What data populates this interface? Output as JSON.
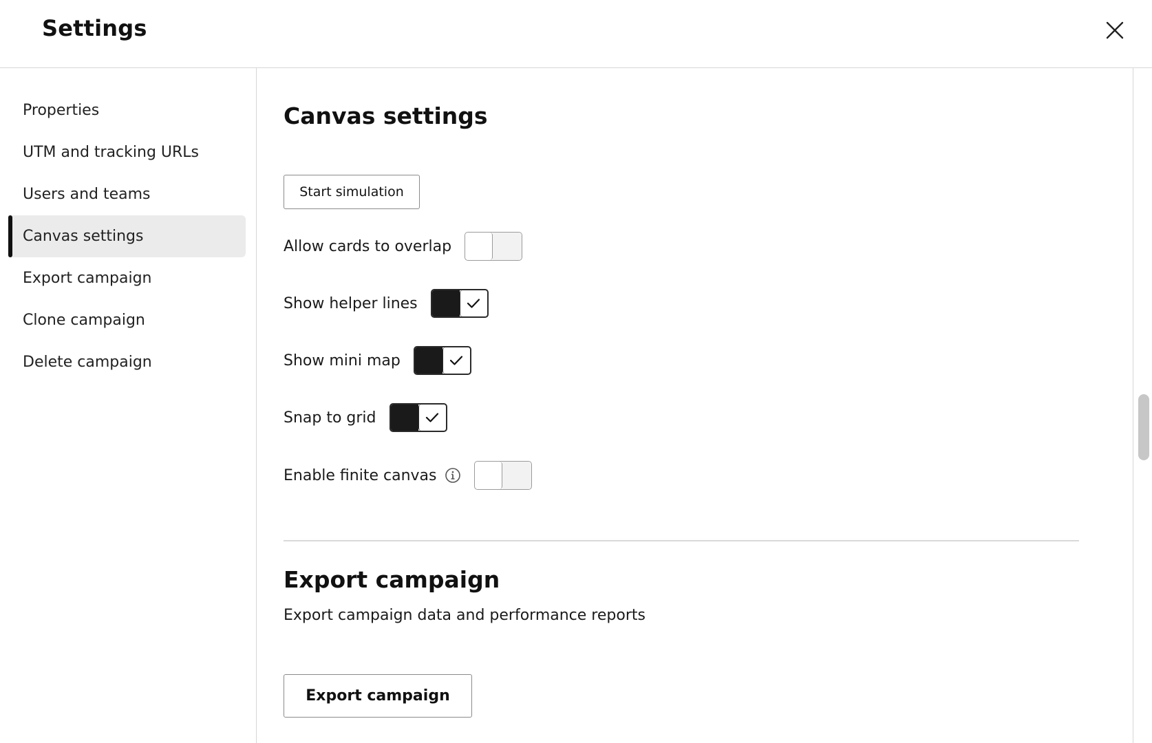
{
  "header": {
    "title": "Settings",
    "close_icon": "close-icon"
  },
  "sidebar": {
    "items": [
      {
        "label": "Properties",
        "active": false
      },
      {
        "label": "UTM and tracking URLs",
        "active": false
      },
      {
        "label": "Users and teams",
        "active": false
      },
      {
        "label": "Canvas settings",
        "active": true
      },
      {
        "label": "Export campaign",
        "active": false
      },
      {
        "label": "Clone campaign",
        "active": false
      },
      {
        "label": "Delete campaign",
        "active": false
      }
    ]
  },
  "canvas_settings": {
    "title": "Canvas settings",
    "start_simulation_label": "Start simulation",
    "options": [
      {
        "label": "Allow cards to overlap",
        "enabled": false
      },
      {
        "label": "Show helper lines",
        "enabled": true
      },
      {
        "label": "Show mini map",
        "enabled": true
      },
      {
        "label": "Snap to grid",
        "enabled": true
      },
      {
        "label": "Enable finite canvas",
        "enabled": false,
        "info_icon": "info-icon"
      }
    ]
  },
  "export_campaign": {
    "title": "Export campaign",
    "description": "Export campaign data and performance reports",
    "button_label": "Export campaign"
  },
  "colors": {
    "toggle_on": "#1a1a1a",
    "toggle_off_track": "#f2f2f2",
    "active_nav_bg": "#ebebeb"
  }
}
